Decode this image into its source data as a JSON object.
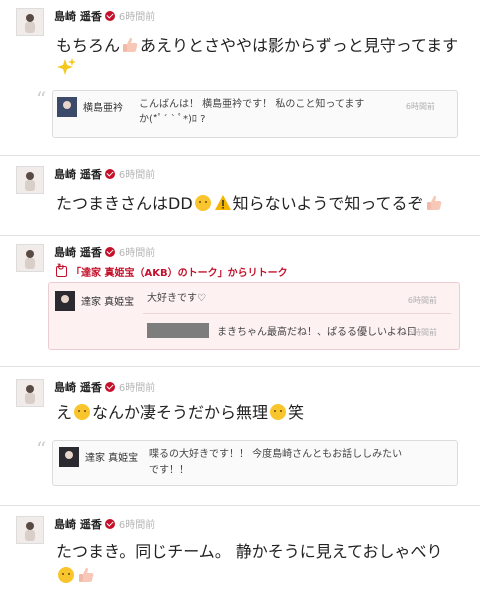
{
  "posts": [
    {
      "author": "島崎 遥香",
      "time": "6時間前",
      "text_a": "もちろん",
      "text_b": "あえりとさややは影からずっと見守ってます",
      "quote": {
        "author": "横島亜衿",
        "text": "こんばんは！ 横島亜衿です！ 私のこと知ってますか(*ﾟ´ ` ﾟ*)ﾛ ?",
        "time": "6時間前"
      }
    },
    {
      "author": "島崎 遥香",
      "time": "6時間前",
      "text_a": "たつまきさんはDD",
      "text_b": "知らないようで知ってるぞ"
    },
    {
      "author": "島崎 遥香",
      "time": "6時間前",
      "retalk": "「達家 真姫宝（AKB）のトーク」からリトーク",
      "quote": {
        "author": "達家 真姫宝",
        "text": "大好きです♡",
        "time": "6時間前",
        "reply_text": "まきちゃん最高だね！、ぱるる優しいよね口",
        "reply_time": "6時間前"
      }
    },
    {
      "author": "島崎 遥香",
      "time": "6時間前",
      "text_a": "え",
      "text_b": "なんか凄そうだから無理",
      "text_c": "笑",
      "quote": {
        "author": "達家 真姫宝",
        "text_line1": "喋るの大好きです！！ 今度島崎さんともお話ししみたい",
        "text_line2": "です！！"
      }
    },
    {
      "author": "島崎 遥香",
      "time": "6時間前",
      "text_a": "たつまき。同じチーム。 静かそうに見えておしゃべり"
    }
  ],
  "colors": {
    "accent": "#c4102a",
    "divider": "#e2e2e2"
  },
  "icons": [
    "verified-icon",
    "thumbs-up-icon",
    "sparkles-icon",
    "warning-icon",
    "yellow-face-icon",
    "retalk-icon",
    "quote-icon"
  ]
}
